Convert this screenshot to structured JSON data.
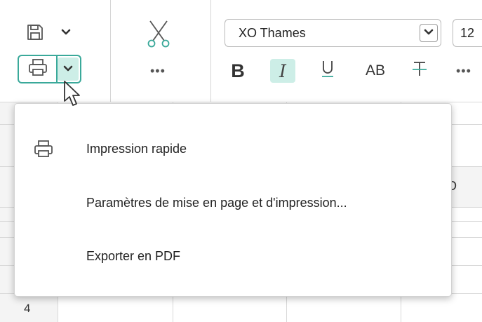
{
  "toolbar": {
    "font_name": "XO Thames",
    "font_size": "12",
    "more_label": "•••",
    "formatting": {
      "bold_label": "B",
      "italic_label": "I",
      "underline_label": "U",
      "case_label": "AB",
      "italic_active": true
    }
  },
  "sheet": {
    "visible_column_label": "D",
    "visible_row_number": "4"
  },
  "print_menu": {
    "items": [
      {
        "label": "Impression rapide",
        "icon": "printer-icon"
      },
      {
        "label": "Paramètres de mise en page et d'impression..."
      },
      {
        "label": "Exporter en PDF"
      }
    ]
  },
  "colors": {
    "accent": "#3aa99a",
    "accent_fill": "#cdeee7"
  }
}
